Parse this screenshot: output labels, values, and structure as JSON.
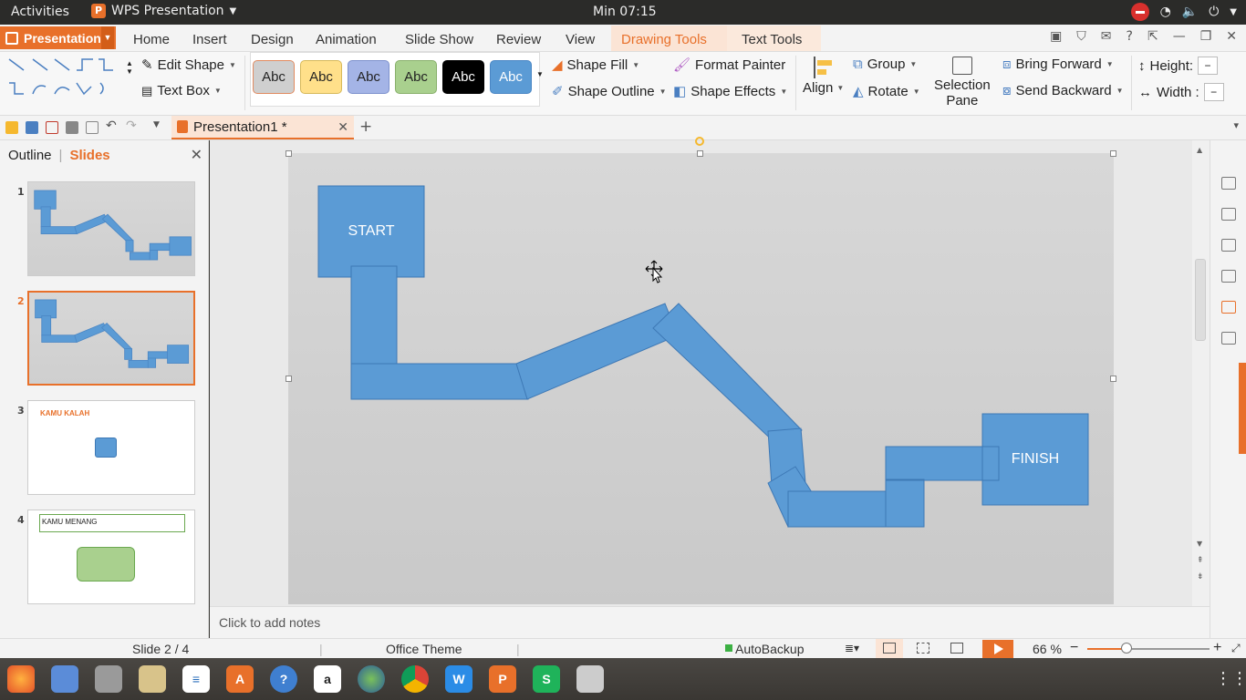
{
  "topbar": {
    "activities": "Activities",
    "app_name": "WPS Presentation",
    "clock": "Min 07:15"
  },
  "tabs": {
    "app_menu": "Presentation",
    "items": [
      "Home",
      "Insert",
      "Design",
      "Animation",
      "Slide Show",
      "Review",
      "View",
      "Drawing Tools",
      "Text Tools"
    ],
    "active": "Drawing Tools"
  },
  "ribbon": {
    "edit_shape": "Edit Shape",
    "text_box": "Text Box",
    "style_labels": [
      "Abc",
      "Abc",
      "Abc",
      "Abc",
      "Abc",
      "Abc"
    ],
    "style_colors": [
      "#cfcfcf",
      "#ffe08a",
      "#a4b4e6",
      "#a9d08e",
      "#000000",
      "#5b9bd5"
    ],
    "shape_fill": "Shape Fill",
    "shape_outline": "Shape Outline",
    "format_painter": "Format Painter",
    "shape_effects": "Shape Effects",
    "align": "Align",
    "group": "Group",
    "rotate": "Rotate",
    "selection_pane_1": "Selection",
    "selection_pane_2": "Pane",
    "bring_forward": "Bring Forward",
    "send_backward": "Send Backward",
    "height_label": "Height:",
    "width_label": "Width :",
    "height_value": "−",
    "width_value": "−"
  },
  "document": {
    "tab_title": "Presentation1 *"
  },
  "panel": {
    "outline_tab": "Outline",
    "slides_tab": "Slides",
    "slides": [
      {
        "num": "1"
      },
      {
        "num": "2"
      },
      {
        "num": "3",
        "text": "KAMU KALAH"
      },
      {
        "num": "4",
        "text": "KAMU MENANG"
      }
    ]
  },
  "slide": {
    "start_label": "START",
    "finish_label": "FINISH",
    "shape_color": "#5b9bd5"
  },
  "notes": {
    "placeholder": "Click to add notes"
  },
  "status": {
    "slide_counter": "Slide 2 / 4",
    "theme": "Office Theme",
    "autobackup": "AutoBackup",
    "zoom": "66 %",
    "zoom_level": 0.32
  },
  "colors": {
    "accent": "#e8702a"
  }
}
